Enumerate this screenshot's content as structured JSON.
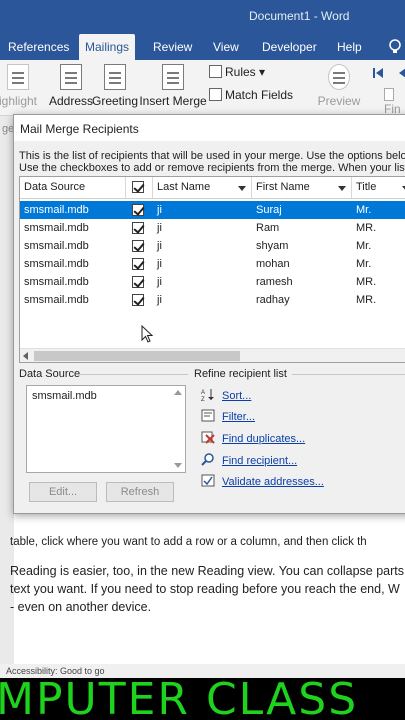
{
  "app": {
    "window_title": "Document1 - Word"
  },
  "ribbon": {
    "tabs": [
      {
        "label": "References"
      },
      {
        "label": "Mailings",
        "active": true
      },
      {
        "label": "Review"
      },
      {
        "label": "View"
      },
      {
        "label": "Developer"
      },
      {
        "label": "Help"
      }
    ],
    "buttons": {
      "highlight": "ighlight",
      "address": "Address",
      "greeting": "Greeting",
      "insert_merge": "Insert Merge",
      "rules": "Rules",
      "match_fields": "Match Fields",
      "preview": "Preview",
      "find_partial": "Fin"
    }
  },
  "document": {
    "left_fragment": "ge",
    "line1": "table, click where you want to add a row or a column, and then click th",
    "line2": "Reading is easier, too, in the new Reading view. You can collapse parts o",
    "line3": "text you want. If you need to stop reading before you reach the end, W",
    "line4": "- even on another device."
  },
  "statusbar": {
    "text": "Accessibility: Good to go"
  },
  "banner": {
    "text": "MPUTER CLASS"
  },
  "dialog": {
    "title": "Mail Merge Recipients",
    "desc1": "This is the list of recipients that will be used in your merge.  Use the options belo",
    "desc2": "Use the checkboxes to add or remove recipients from the merge.  When your list",
    "columns": [
      "Data Source",
      "",
      "Last Name",
      "First Name",
      "Title"
    ],
    "rows": [
      {
        "source": "smsmail.mdb",
        "last": "ji",
        "first": "Suraj",
        "title": "Mr.",
        "checked": true,
        "selected": true
      },
      {
        "source": "smsmail.mdb",
        "last": "ji",
        "first": "Ram",
        "title": "MR.",
        "checked": true
      },
      {
        "source": "smsmail.mdb",
        "last": "ji",
        "first": "shyam",
        "title": "Mr.",
        "checked": true
      },
      {
        "source": "smsmail.mdb",
        "last": "ji",
        "first": "mohan",
        "title": "Mr.",
        "checked": true
      },
      {
        "source": "smsmail.mdb",
        "last": "ji",
        "first": "ramesh",
        "title": "MR.",
        "checked": true
      },
      {
        "source": "smsmail.mdb",
        "last": "ji",
        "first": "radhay",
        "title": "MR.",
        "checked": true
      }
    ],
    "data_source_label": "Data Source",
    "data_source_items": [
      "smsmail.mdb"
    ],
    "edit_button": "Edit...",
    "refresh_button": "Refresh",
    "refine_label": "Refine recipient list",
    "refine_links": {
      "sort": "Sort...",
      "filter": "Filter...",
      "find_duplicates": "Find duplicates...",
      "find_recipient": "Find recipient...",
      "validate_addresses": "Validate addresses..."
    }
  },
  "colors": {
    "ribbon_blue": "#2b579a",
    "selection_blue": "#0078d7",
    "banner_green": "#1ed21e",
    "link_blue": "#0a3ea8"
  }
}
